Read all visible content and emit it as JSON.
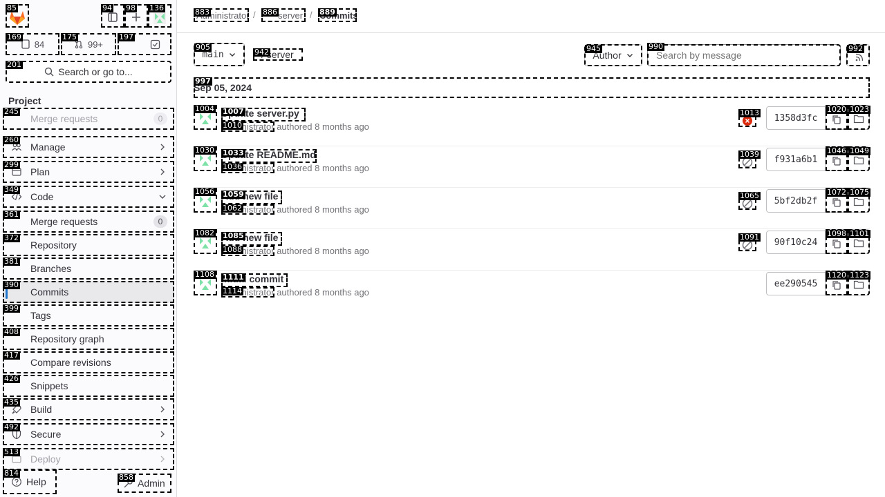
{
  "sidebar": {
    "top": {
      "logo_tag": "85",
      "panel_tag": "94",
      "new_tag": "98",
      "avatar_tag": "136"
    },
    "counters": [
      {
        "tag": "169",
        "icon": "issues-icon",
        "value": "84"
      },
      {
        "tag": "175",
        "icon": "merge-request-icon",
        "value": "99+"
      },
      {
        "tag": "197",
        "icon": "todo-icon",
        "value": ""
      }
    ],
    "search": {
      "tag": "201",
      "label": "Search or go to..."
    },
    "section_label": "Project",
    "items": [
      {
        "tag": "245",
        "label": "Merge requests",
        "badge": "0"
      },
      {
        "tag": "260",
        "label": "Manage",
        "icon": "users-icon"
      },
      {
        "tag": "299",
        "label": "Plan",
        "icon": "planning-icon"
      },
      {
        "tag": "349",
        "label": "Code",
        "icon": "code-icon"
      },
      {
        "tag": "361",
        "label": "Merge requests",
        "badge": "0"
      },
      {
        "tag": "372",
        "label": "Repository"
      },
      {
        "tag": "381",
        "label": "Branches"
      },
      {
        "tag": "390",
        "label": "Commits"
      },
      {
        "tag": "399",
        "label": "Tags"
      },
      {
        "tag": "408",
        "label": "Repository graph"
      },
      {
        "tag": "417",
        "label": "Compare revisions"
      },
      {
        "tag": "426",
        "label": "Snippets"
      },
      {
        "tag": "435",
        "label": "Build",
        "icon": "rocket-icon"
      },
      {
        "tag": "492",
        "label": "Secure",
        "icon": "shield-icon"
      },
      {
        "tag": "513",
        "label": "Deploy",
        "icon": "deploy-icon"
      }
    ],
    "footer": {
      "help_tag": "814",
      "help_label": "Help",
      "admin_tag": "858",
      "admin_label": "Admin"
    }
  },
  "breadcrumb": [
    {
      "tag": "883",
      "label": "Administrator"
    },
    {
      "tag": "886",
      "label": "server"
    },
    {
      "tag": "889",
      "label": "Commits"
    }
  ],
  "toolbar": {
    "branch_tag": "905",
    "branch_label": "main",
    "path_tag": "942",
    "path_label": "/ server",
    "author_tag": "945",
    "author_label": "Author",
    "search_tag": "990",
    "search_placeholder": "Search by message",
    "rss_tag": "992"
  },
  "date_group": {
    "tag": "997",
    "label": "Sep 05, 2024"
  },
  "commits": [
    {
      "avatar_tag": "1004",
      "title_tag": "1007",
      "meta_tag": "1010",
      "title": "Update server.py",
      "author": "Administrator",
      "meta": "authored 8 months ago",
      "status_tag": "1013",
      "status": "failed",
      "sha": "1358d3fc",
      "copy_tag": "1020",
      "browse_tag": "1023"
    },
    {
      "avatar_tag": "1030",
      "title_tag": "1033",
      "meta_tag": "1036",
      "title": "Update README.md",
      "author": "Administrator",
      "meta": "authored 8 months ago",
      "status_tag": "1039",
      "status": "skipped",
      "sha": "f931a6b1",
      "copy_tag": "1046",
      "browse_tag": "1049"
    },
    {
      "avatar_tag": "1056",
      "title_tag": "1059",
      "meta_tag": "1062",
      "title": "Add new file",
      "author": "Administrator",
      "meta": "authored 8 months ago",
      "status_tag": "1065",
      "status": "skipped",
      "sha": "5bf2db2f",
      "copy_tag": "1072",
      "browse_tag": "1075"
    },
    {
      "avatar_tag": "1082",
      "title_tag": "1085",
      "meta_tag": "1088",
      "title": "Add new file",
      "author": "Administrator",
      "meta": "authored 8 months ago",
      "status_tag": "1091",
      "status": "skipped",
      "sha": "90f10c24",
      "copy_tag": "1098",
      "browse_tag": "1101"
    },
    {
      "avatar_tag": "1108",
      "title_tag": "1111",
      "meta_tag": "1114",
      "title": "Initial commit",
      "author": "Administrator",
      "meta": "authored 8 months ago",
      "status_tag": "",
      "status": "none",
      "sha": "ee290545",
      "copy_tag": "1120",
      "browse_tag": "1123"
    }
  ],
  "colors": {
    "accent": "#1f75cb",
    "failed": "#dd2b0e",
    "skipped": "#737278",
    "avatar": "#7ee2a8"
  }
}
